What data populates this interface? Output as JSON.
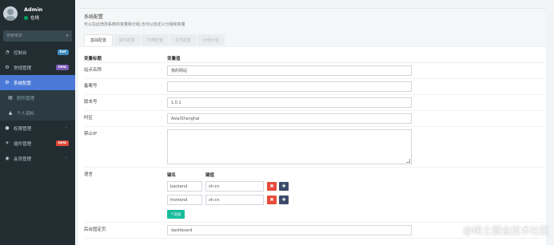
{
  "user": {
    "name": "Admin",
    "status": "在线"
  },
  "search": {
    "placeholder": "搜索菜单"
  },
  "menu": [
    {
      "label": "控制台",
      "icon": "dashboard-icon",
      "badge": "hot"
    },
    {
      "label": "常规管理",
      "icon": "cogs-icon",
      "badge": "new"
    },
    {
      "label": "系统配置",
      "icon": "gear-icon",
      "active": true
    },
    {
      "label": "附件管理",
      "icon": "file-icon",
      "sub": true
    },
    {
      "label": "个人资料",
      "icon": "user-icon",
      "sub": true
    },
    {
      "label": "权限管理",
      "icon": "group-icon",
      "chevron": true
    },
    {
      "label": "插件管理",
      "icon": "rocket-icon",
      "badge": "new"
    },
    {
      "label": "会员管理",
      "icon": "user-circle-icon",
      "chevron": true
    }
  ],
  "panel": {
    "title": "系统配置",
    "desc": "可以在此增改系统的变量和分组,也可以自定义分组和变量",
    "tabs": [
      "基础配置",
      "邮件配置",
      "字典配置",
      "会员配置",
      "示例分组"
    ]
  },
  "form": {
    "col_title": "变量标题",
    "col_value": "变量值",
    "fields": [
      {
        "label": "站点名称",
        "value": "我的网站"
      },
      {
        "label": "备案号",
        "value": ""
      },
      {
        "label": "版本号",
        "value": "1.0.1"
      },
      {
        "label": "时区",
        "value": "Asia/Shanghai"
      }
    ],
    "forbidden_ip": {
      "label": "禁止IP",
      "value": ""
    },
    "language": {
      "label": "语言",
      "key_head": "键名",
      "val_head": "键值",
      "rows": [
        {
          "key": "backend",
          "value": "zh-cn"
        },
        {
          "key": "frontend",
          "value": "zh-cn"
        }
      ],
      "add_label": "追加"
    },
    "backend_home": {
      "label": "后台固定页",
      "value": "dashboard"
    }
  },
  "watermark": "@稀土掘金技术社区",
  "colors": {
    "sidebar": "#222d32",
    "active": "#4a79d8",
    "danger": "#e74c3c",
    "success": "#18bc9c"
  }
}
